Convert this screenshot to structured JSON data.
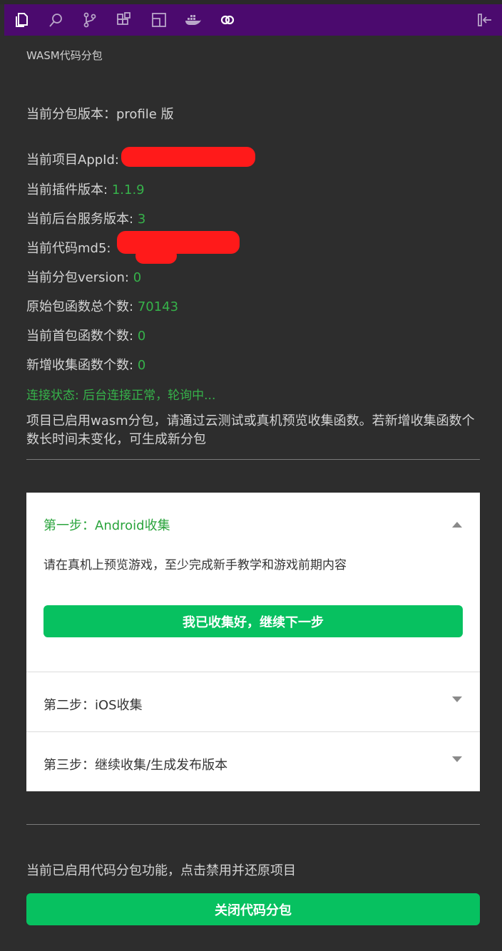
{
  "activity_bar": {
    "icons": [
      "files-icon",
      "search-icon",
      "source-control-icon",
      "extensions-icon",
      "layout-icon",
      "docker-icon",
      "plugin-icon",
      "collapse-panel-icon"
    ],
    "accent_color": "#4b0a6e"
  },
  "panel": {
    "title": "WASM代码分包"
  },
  "info": {
    "version_label": "当前分包版本：profile 版",
    "appid_label": "当前项目AppId:",
    "plugin_version_label": "当前插件版本:",
    "plugin_version_value": "1.1.9",
    "service_version_label": "当前后台服务版本:",
    "service_version_value": "3",
    "md5_label": "当前代码md5:",
    "subpkg_version_label": "当前分包version:",
    "subpkg_version_value": "0",
    "orig_func_label": "原始包函数总个数:",
    "orig_func_value": "70143",
    "first_func_label": "当前首包函数个数:",
    "first_func_value": "0",
    "new_func_label": "新增收集函数个数:",
    "new_func_value": "0",
    "connection_status": "连接状态: 后台连接正常，轮询中..."
  },
  "notice": "项目已启用wasm分包，请通过云测试或真机预览收集函数。若新增收集函数个数长时间未变化，可生成新分包",
  "steps": {
    "step1_title": "第一步：Android收集",
    "step1_desc": "请在真机上预览游戏，至少完成新手教学和游戏前期内容",
    "step1_button": "我已收集好，继续下一步",
    "step2_title": "第二步：iOS收集",
    "step3_title": "第三步：继续收集/生成发布版本"
  },
  "footer": {
    "text": "当前已启用代码分包功能，点击禁用并还原项目",
    "button": "关闭代码分包"
  },
  "colors": {
    "green_text": "#36b24a",
    "button_green": "#07c160"
  }
}
